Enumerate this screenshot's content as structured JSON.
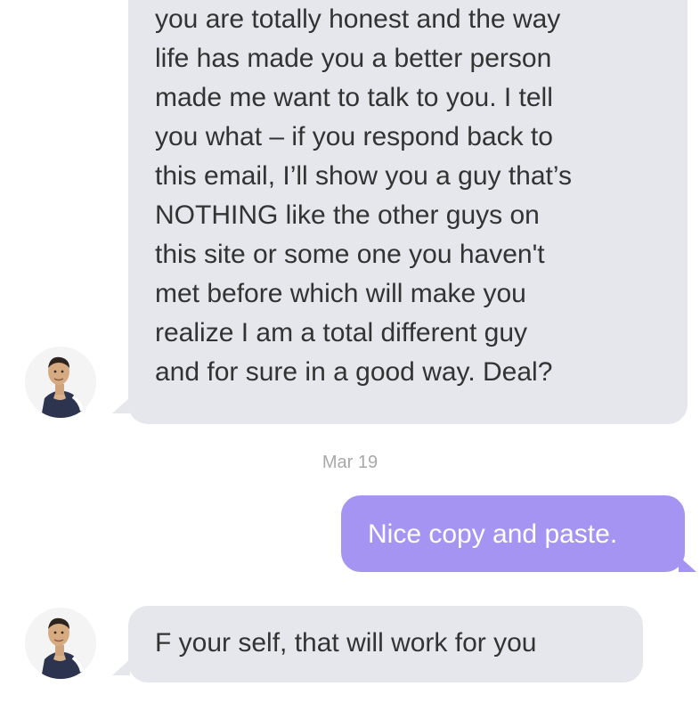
{
  "thread": {
    "messages": [
      {
        "lines": [
          "you are totally honest and the way",
          "life has made you a better person",
          "made me want to talk to you. I tell",
          "you what – if you respond back to",
          "this email, I’ll show you a guy that’s",
          "NOTHING like the other guys on",
          "this site or some one you haven't",
          "met before which will make you",
          "realize I am a total different guy",
          "and for sure in a good way. Deal?"
        ]
      },
      {
        "text": "Nice copy and paste."
      },
      {
        "text": "F your self, that will work for you"
      }
    ],
    "date_stamp": "Mar 19"
  },
  "colors": {
    "incoming_bubble": "#e6e7ec",
    "outgoing_bubble": "#a594f2",
    "incoming_text": "#333333",
    "outgoing_text": "#ffffff",
    "date_text": "#a8a8a8"
  },
  "icons": {
    "contact_avatar": "avatar"
  }
}
